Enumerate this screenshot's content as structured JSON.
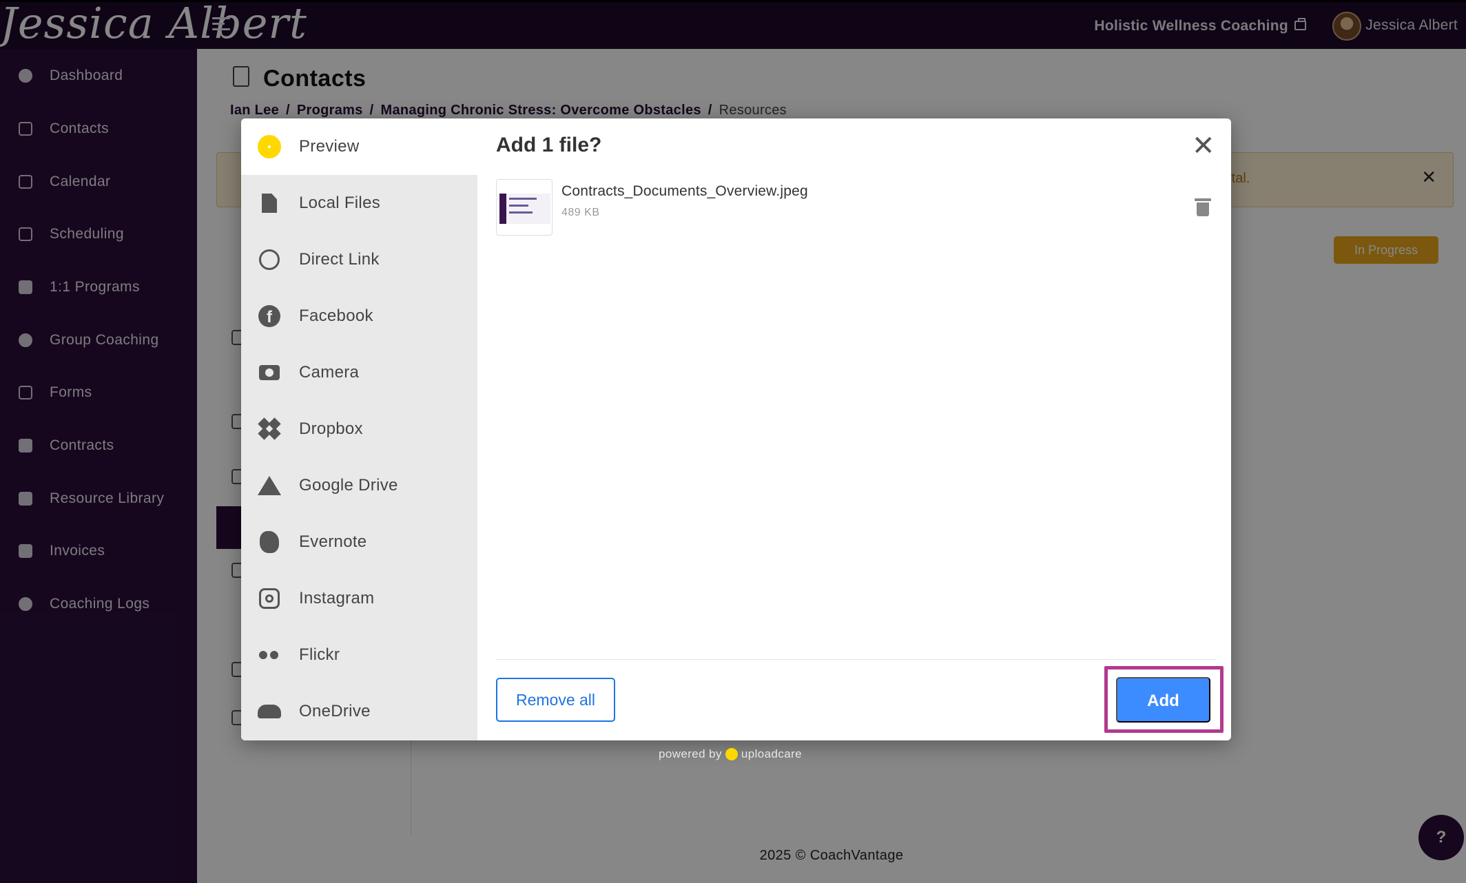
{
  "topbar": {
    "logo_text": "Jessica Albert",
    "business_name": "Holistic Wellness Coaching",
    "user_name": "Jessica Albert"
  },
  "sidebar": {
    "items": [
      {
        "label": "Dashboard",
        "icon": "dashboard-icon"
      },
      {
        "label": "Contacts",
        "icon": "contacts-icon"
      },
      {
        "label": "Calendar",
        "icon": "calendar-icon"
      },
      {
        "label": "Scheduling",
        "icon": "scheduling-icon"
      },
      {
        "label": "1:1 Programs",
        "icon": "book-icon"
      },
      {
        "label": "Group Coaching",
        "icon": "group-icon"
      },
      {
        "label": "Forms",
        "icon": "checklist-icon"
      },
      {
        "label": "Contracts",
        "icon": "signature-icon"
      },
      {
        "label": "Resource Library",
        "icon": "library-icon"
      },
      {
        "label": "Invoices",
        "icon": "invoice-icon"
      },
      {
        "label": "Coaching Logs",
        "icon": "clock-icon"
      }
    ]
  },
  "page": {
    "title": "Contacts",
    "breadcrumb": [
      "Ian Lee",
      "Programs",
      "Managing Chronic Stress: Overcome Obstacles"
    ],
    "breadcrumb_current": "Resources",
    "banner_text_visible": "rtal.",
    "status_label": "In Progress",
    "footer": "2025 © CoachVantage",
    "help_label": "?"
  },
  "modal": {
    "sources": [
      {
        "label": "Preview",
        "icon": "preview-icon",
        "active": true
      },
      {
        "label": "Local Files",
        "icon": "file-icon"
      },
      {
        "label": "Direct Link",
        "icon": "link-icon"
      },
      {
        "label": "Facebook",
        "icon": "facebook-icon"
      },
      {
        "label": "Camera",
        "icon": "camera-icon"
      },
      {
        "label": "Dropbox",
        "icon": "dropbox-icon"
      },
      {
        "label": "Google Drive",
        "icon": "google-drive-icon"
      },
      {
        "label": "Evernote",
        "icon": "evernote-icon"
      },
      {
        "label": "Instagram",
        "icon": "instagram-icon"
      },
      {
        "label": "Flickr",
        "icon": "flickr-icon"
      },
      {
        "label": "OneDrive",
        "icon": "onedrive-icon"
      }
    ],
    "title": "Add 1 file?",
    "file": {
      "name": "Contracts_Documents_Overview.jpeg",
      "size": "489 KB"
    },
    "remove_all_label": "Remove all",
    "add_label": "Add",
    "powered_by": "powered by",
    "powered_brand": "uploadcare"
  },
  "colors": {
    "sidebar_bg": "#2a0f3a",
    "topbar_bg": "#1e0a2b",
    "accent_blue": "#3d8cff",
    "highlight": "#b23a8e",
    "uploadcare_yellow": "#ffd800",
    "status_orange": "#e8a71c"
  }
}
